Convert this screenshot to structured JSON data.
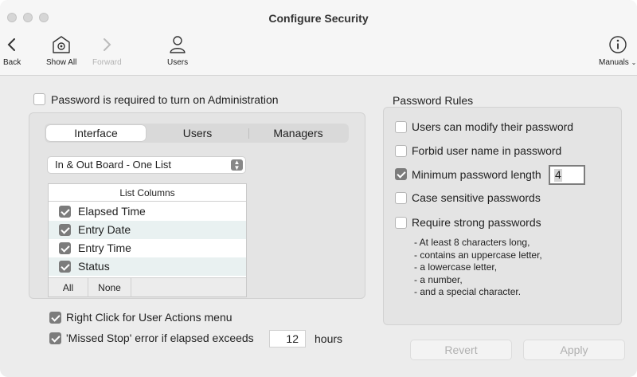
{
  "window": {
    "title": "Configure Security"
  },
  "toolbar": {
    "back": "Back",
    "show_all": "Show All",
    "forward": "Forward",
    "users": "Users",
    "manuals": "Manuals"
  },
  "admin_password": {
    "label": "Password is required to turn on Administration",
    "checked": false
  },
  "tabs": {
    "items": [
      "Interface",
      "Users",
      "Managers"
    ],
    "selected": "Interface"
  },
  "list_select": {
    "value": "In & Out Board - One List"
  },
  "list_columns": {
    "header": "List Columns",
    "rows": [
      {
        "label": "Elapsed Time",
        "checked": true
      },
      {
        "label": "Entry Date",
        "checked": true
      },
      {
        "label": "Entry Time",
        "checked": true
      },
      {
        "label": "Status",
        "checked": true
      }
    ],
    "all_label": "All",
    "none_label": "None"
  },
  "right_click": {
    "label": "Right Click for User Actions menu",
    "checked": true
  },
  "missed_stop": {
    "label": "'Missed Stop' error if elapsed exceeds",
    "value": "12",
    "unit": "hours",
    "checked": true
  },
  "password_rules": {
    "title": "Password Rules",
    "modify": {
      "label": "Users can modify their password",
      "checked": false
    },
    "forbid": {
      "label": "Forbid user name in password",
      "checked": false
    },
    "min_length": {
      "label": "Minimum password length",
      "value": "4",
      "checked": true
    },
    "case": {
      "label": "Case sensitive passwords",
      "checked": false
    },
    "strong": {
      "label": "Require strong passwords",
      "checked": false
    },
    "requirements": [
      "- At least 8 characters long,",
      "- contains an uppercase letter,",
      "- a lowercase letter,",
      "- a number,",
      "- and a special character."
    ]
  },
  "buttons": {
    "revert": "Revert",
    "apply": "Apply"
  },
  "colors": {
    "checkbox_on": "#7c7c7c",
    "alt_row": "#e9f1f1",
    "panel": "#e4e4e4"
  }
}
